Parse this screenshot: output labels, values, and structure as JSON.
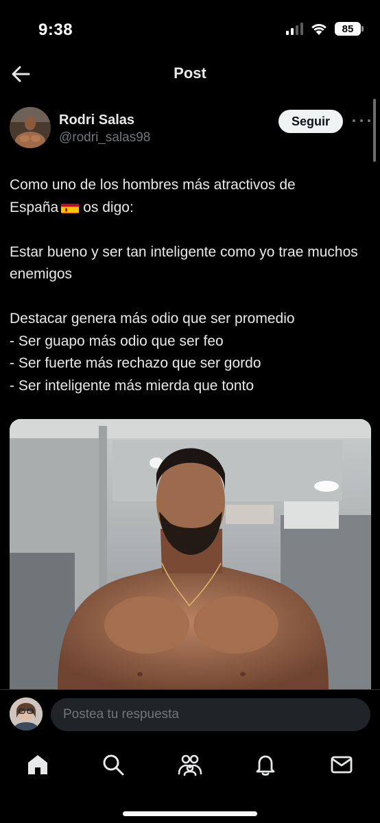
{
  "status_bar": {
    "time": "9:38",
    "battery": "85",
    "icons": [
      "signal-icon",
      "wifi-icon",
      "battery-icon"
    ]
  },
  "header": {
    "title": "Post",
    "back_icon": "arrow-left-icon"
  },
  "author": {
    "name": "Rodri Salas",
    "handle": "@rodri_salas98",
    "follow_label": "Seguir",
    "more_icon": "more-horizontal-icon"
  },
  "tweet": {
    "line1a": "Como uno de los hombres más atractivos de",
    "line1b": "España",
    "line1c": "os digo:",
    "para2": "Estar bueno y ser tan inteligente como yo trae muchos enemigos",
    "para3": [
      "Destacar genera más odio que ser promedio",
      "- Ser guapo más odio que ser feo",
      "- Ser fuerte más rechazo que ser gordo",
      "- Ser inteligente más mierda que tonto"
    ],
    "flag_icon": "spain-flag-icon"
  },
  "reply": {
    "placeholder": "Postea tu respuesta"
  },
  "bottom_nav": {
    "items": [
      "home-icon",
      "search-icon",
      "communities-icon",
      "notifications-icon",
      "messages-icon"
    ]
  },
  "colors": {
    "background": "#000000",
    "text_primary": "#e7e9ea",
    "text_secondary": "#71767b",
    "follow_bg": "#eff3f4",
    "input_bg": "#202327"
  }
}
